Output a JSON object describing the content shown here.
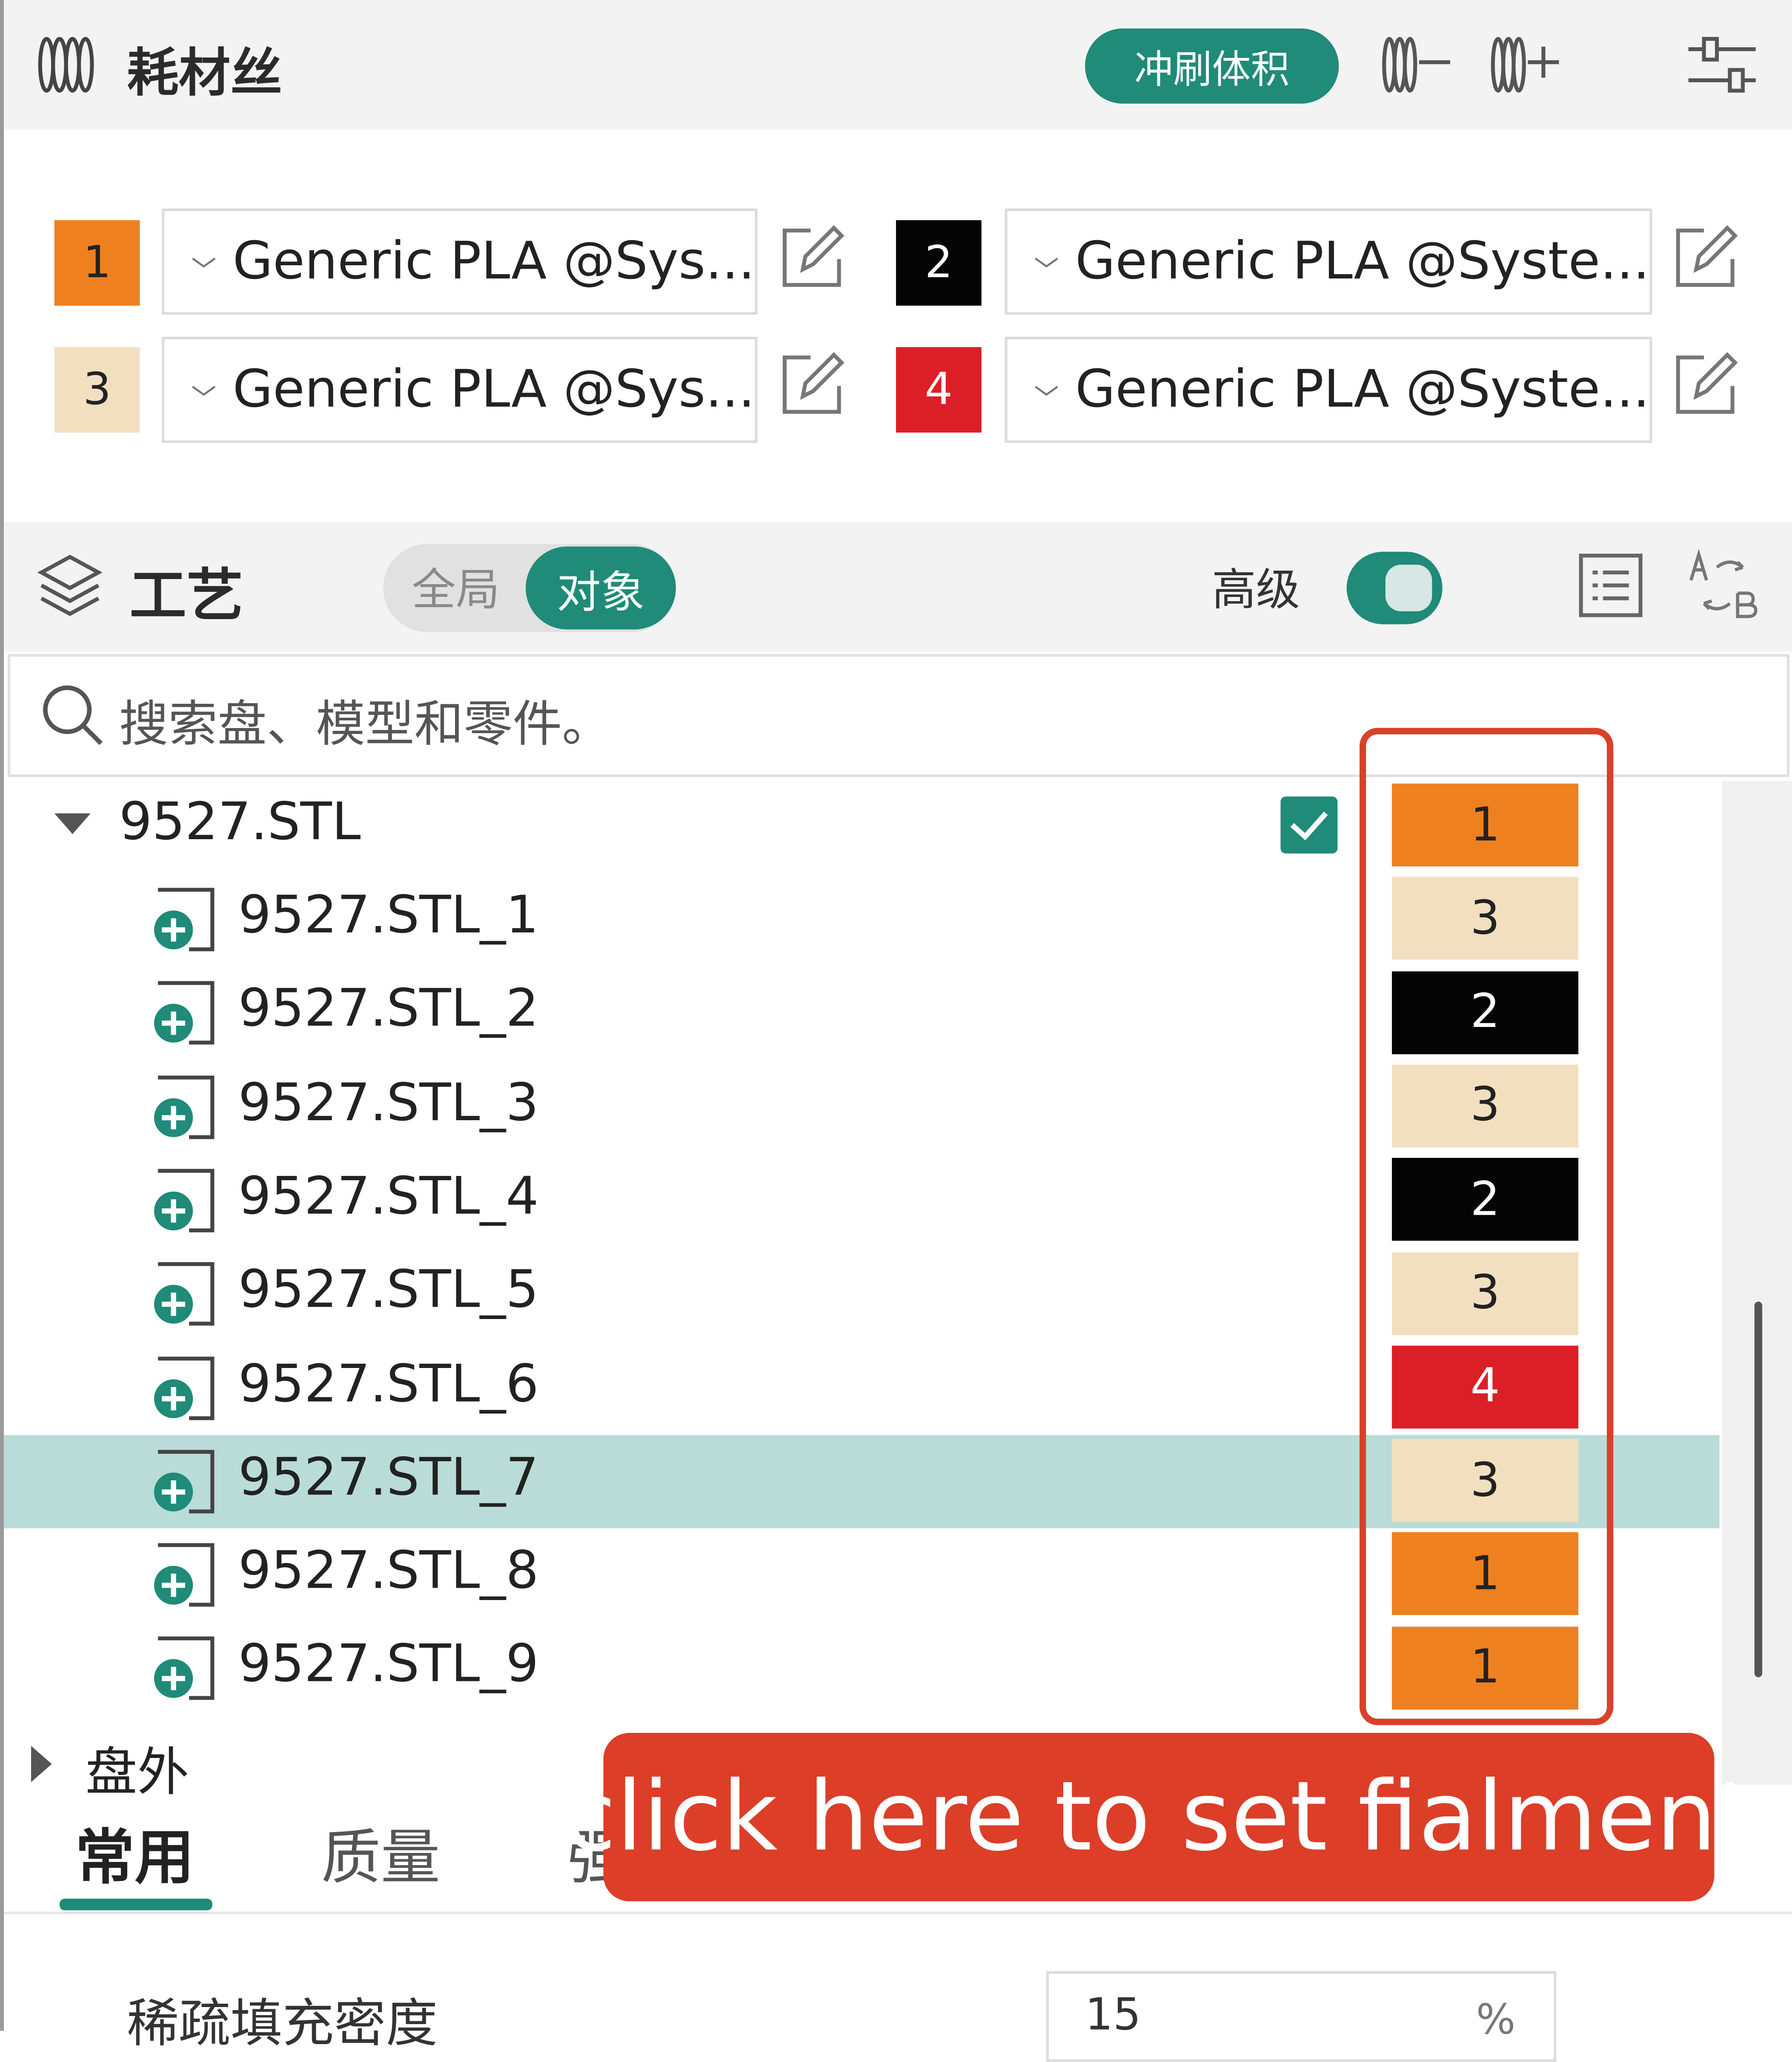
{
  "filament": {
    "title": "耗材丝",
    "flush_volume_button": "冲刷体积",
    "slots": [
      {
        "num": "1",
        "color": "#ee801f",
        "text_color": "#222222",
        "name": "Generic PLA @Sys..."
      },
      {
        "num": "2",
        "color": "#050505",
        "text_color": "#ffffff",
        "name": "Generic PLA @Syste..."
      },
      {
        "num": "3",
        "color": "#f2dfc0",
        "text_color": "#222222",
        "name": "Generic PLA @Sys..."
      },
      {
        "num": "4",
        "color": "#dc1f26",
        "text_color": "#ffffff",
        "name": "Generic PLA @Syste..."
      }
    ]
  },
  "process": {
    "title": "工艺",
    "toggle_global": "全局",
    "toggle_object": "对象",
    "advanced_label": "高级",
    "advanced_on": true
  },
  "search": {
    "placeholder": "搜索盘、模型和零件。"
  },
  "tree": {
    "root": {
      "label": "9527.STL",
      "checked": true,
      "filament": "1"
    },
    "parts": [
      {
        "label": "9527.STL_1",
        "filament": "3"
      },
      {
        "label": "9527.STL_2",
        "filament": "2"
      },
      {
        "label": "9527.STL_3",
        "filament": "3"
      },
      {
        "label": "9527.STL_4",
        "filament": "2"
      },
      {
        "label": "9527.STL_5",
        "filament": "3"
      },
      {
        "label": "9527.STL_6",
        "filament": "4"
      },
      {
        "label": "9527.STL_7",
        "filament": "3",
        "selected": true
      },
      {
        "label": "9527.STL_8",
        "filament": "1"
      },
      {
        "label": "9527.STL_9",
        "filament": "1"
      }
    ],
    "outside_group": "盘外"
  },
  "annotation": {
    "callout": "click here to set fialment",
    "color": "#dc3e28"
  },
  "settings_tabs": {
    "tab1": "常用",
    "tab2": "质量",
    "tab3_partial": "强"
  },
  "params": {
    "sparse_infill_label": "稀疏填充密度",
    "sparse_infill_value": "15",
    "sparse_infill_unit": "%"
  },
  "colors": {
    "accent": "#1f8b78",
    "selected_row": "#b9dcd8"
  }
}
